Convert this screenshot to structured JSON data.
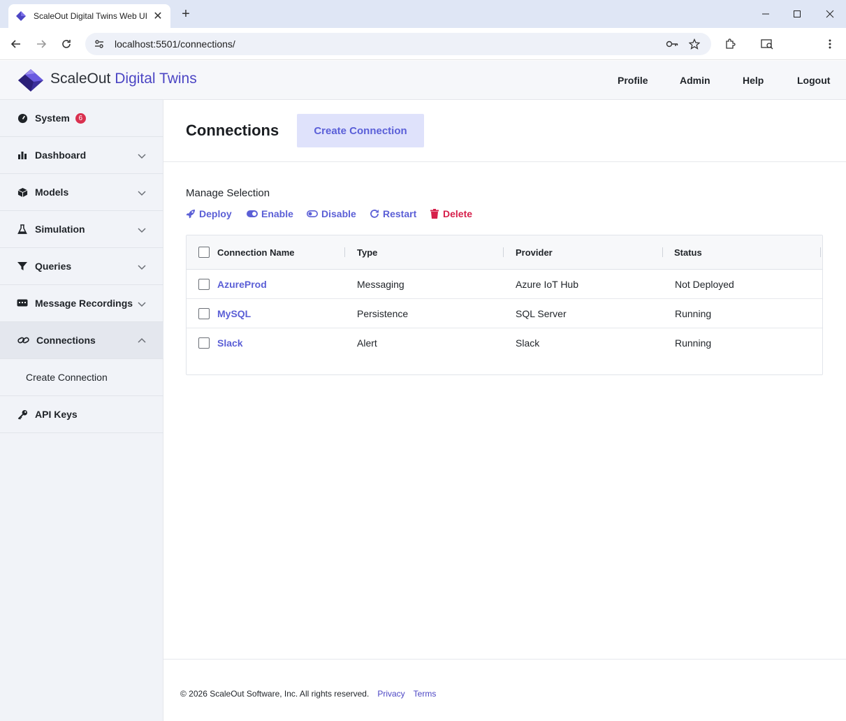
{
  "browser": {
    "tab_title": "ScaleOut Digital Twins Web UI",
    "url": "localhost:5501/connections/"
  },
  "header": {
    "brand_main": "ScaleOut",
    "brand_accent": "Digital Twins",
    "nav": [
      "Profile",
      "Admin",
      "Help",
      "Logout"
    ]
  },
  "sidebar": {
    "items": [
      {
        "label": "System",
        "icon": "gauge-icon",
        "badge": "6"
      },
      {
        "label": "Dashboard",
        "icon": "bar-chart-icon"
      },
      {
        "label": "Models",
        "icon": "cube-icon"
      },
      {
        "label": "Simulation",
        "icon": "flask-icon"
      },
      {
        "label": "Queries",
        "icon": "filter-icon"
      },
      {
        "label": "Message Recordings",
        "icon": "message-icon"
      },
      {
        "label": "Connections",
        "icon": "link-icon"
      },
      {
        "label": "API Keys",
        "icon": "key-icon"
      }
    ],
    "sub_item": "Create Connection"
  },
  "main": {
    "title": "Connections",
    "create_button": "Create Connection",
    "manage_label": "Manage Selection",
    "actions": [
      "Deploy",
      "Enable",
      "Disable",
      "Restart",
      "Delete"
    ]
  },
  "table": {
    "headers": [
      "Connection Name",
      "Type",
      "Provider",
      "Status"
    ],
    "rows": [
      {
        "name": "AzureProd",
        "type": "Messaging",
        "provider": "Azure IoT Hub",
        "status": "Not Deployed"
      },
      {
        "name": "MySQL",
        "type": "Persistence",
        "provider": "SQL Server",
        "status": "Running"
      },
      {
        "name": "Slack",
        "type": "Alert",
        "provider": "Slack",
        "status": "Running"
      }
    ]
  },
  "footer": {
    "copyright": "© 2026 ScaleOut Software, Inc. All rights reserved.",
    "privacy": "Privacy",
    "terms": "Terms"
  },
  "colors": {
    "accent": "#5b5fd6",
    "danger": "#d6204b",
    "badge": "#d9304f"
  }
}
